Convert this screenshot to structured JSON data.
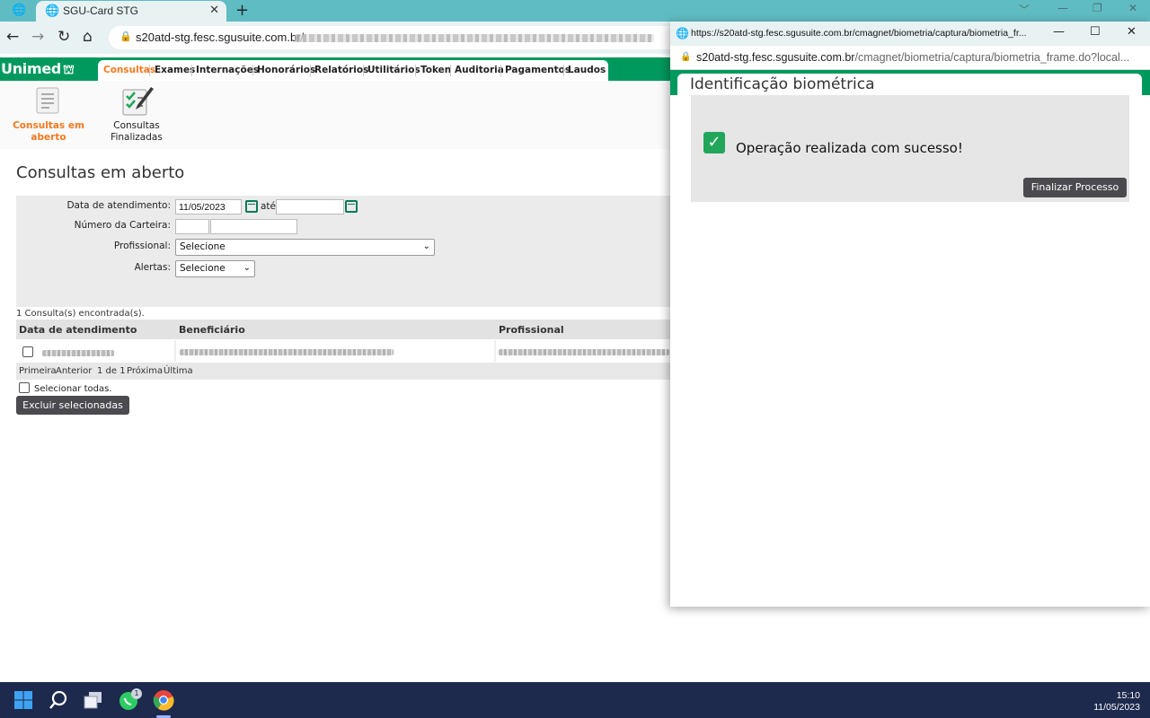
{
  "browser": {
    "tab_title": "SGU-Card STG",
    "new_tab_symbol": "+",
    "close_tab_symbol": "✕",
    "url_visible": "s20atd-stg.fesc.sgusuite.com.br/",
    "window_controls": [
      "﹀",
      "—",
      "❐",
      "✕"
    ]
  },
  "app": {
    "logo_text": "Unimed",
    "menu": [
      "Consultas",
      "Exames",
      "Internações",
      "Honorários",
      "Relatórios",
      "Utilitários",
      "Token",
      "Auditoria",
      "Pagamentos",
      "Laudos"
    ],
    "active_menu": "Consultas",
    "subnav": {
      "open_line1": "Consultas em",
      "open_line2": "aberto",
      "done_line1": "Consultas",
      "done_line2": "Finalizadas"
    },
    "page_title": "Consultas em aberto",
    "filters": {
      "date_label": "Data de atendimento:",
      "date_from": "11/05/2023",
      "date_to": "",
      "ate": "até",
      "card_label": "Número da Carteira:",
      "professional_label": "Profissional:",
      "professional_value": "Selecione",
      "alerts_label": "Alertas:",
      "alerts_value": "Selecione"
    },
    "results": {
      "found_text": "1 Consulta(s) encontrada(s).",
      "columns": [
        "Data de atendimento",
        "Beneficiário",
        "Profissional"
      ],
      "pager": [
        "Primeira",
        "Anterior",
        "1 de 1",
        "Próxima",
        "Última"
      ],
      "select_all": "Selecionar todas.",
      "delete_button": "Excluir selecionadas"
    }
  },
  "popup": {
    "title_url": "https://s20atd-stg.fesc.sgusuite.com.br/cmagnet/biometria/captura/biometria_fr...",
    "url_host": "s20atd-stg.fesc.sgusuite.com.br",
    "url_path": "/cmagnet/biometria/captura/biometria_frame.do?local...",
    "heading": "Identificação biométrica",
    "success_message": "Operação realizada com sucesso!",
    "finish_button": "Finalizar Processo"
  },
  "taskbar": {
    "time": "15:10",
    "date": "11/05/2023",
    "whatsapp_badge": "1"
  },
  "colors": {
    "brand_green": "#00995d",
    "accent_orange": "#f47920",
    "success_green": "#21a65b",
    "chrome_teal": "#60bcc3",
    "taskbar": "#1d2a4d"
  }
}
